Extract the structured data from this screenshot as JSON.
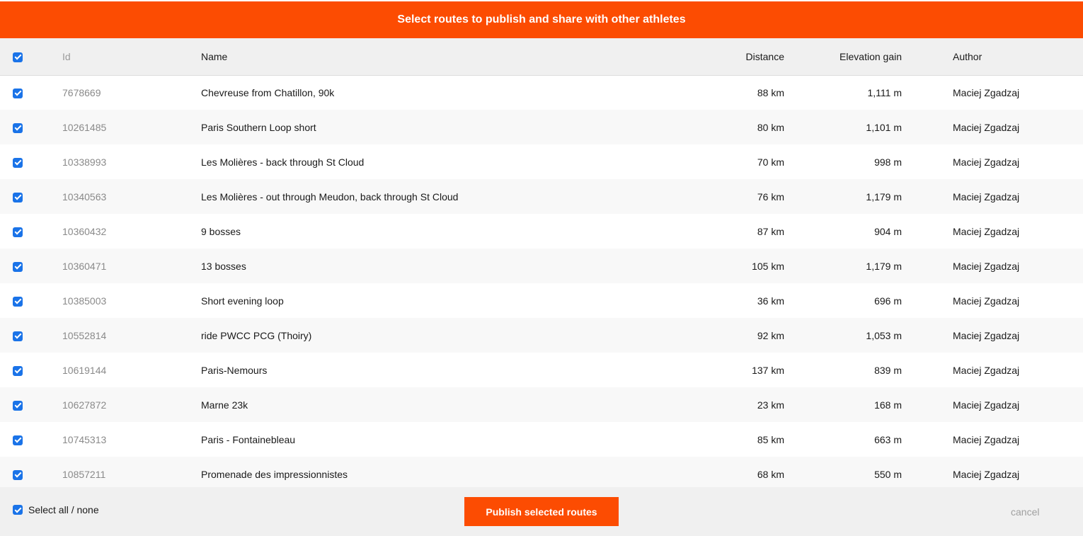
{
  "banner": {
    "title": "Select routes to publish and share with other athletes"
  },
  "colors": {
    "accent": "#fc4c02",
    "checkbox": "#1a73e8"
  },
  "table": {
    "header_checked": true,
    "columns": {
      "id": "Id",
      "name": "Name",
      "distance": "Distance",
      "elevation": "Elevation gain",
      "author": "Author"
    },
    "rows": [
      {
        "checked": true,
        "id": "7678669",
        "name": "Chevreuse from Chatillon, 90k",
        "distance": "88 km",
        "elevation": "1,111 m",
        "author": "Maciej Zgadzaj"
      },
      {
        "checked": true,
        "id": "10261485",
        "name": "Paris Southern Loop short",
        "distance": "80 km",
        "elevation": "1,101 m",
        "author": "Maciej Zgadzaj"
      },
      {
        "checked": true,
        "id": "10338993",
        "name": "Les Molières - back through St Cloud",
        "distance": "70 km",
        "elevation": "998 m",
        "author": "Maciej Zgadzaj"
      },
      {
        "checked": true,
        "id": "10340563",
        "name": "Les Molières - out through Meudon, back through St Cloud",
        "distance": "76 km",
        "elevation": "1,179 m",
        "author": "Maciej Zgadzaj"
      },
      {
        "checked": true,
        "id": "10360432",
        "name": "9 bosses",
        "distance": "87 km",
        "elevation": "904 m",
        "author": "Maciej Zgadzaj"
      },
      {
        "checked": true,
        "id": "10360471",
        "name": "13 bosses",
        "distance": "105 km",
        "elevation": "1,179 m",
        "author": "Maciej Zgadzaj"
      },
      {
        "checked": true,
        "id": "10385003",
        "name": "Short evening loop",
        "distance": "36 km",
        "elevation": "696 m",
        "author": "Maciej Zgadzaj"
      },
      {
        "checked": true,
        "id": "10552814",
        "name": "ride PWCC PCG (Thoiry)",
        "distance": "92 km",
        "elevation": "1,053 m",
        "author": "Maciej Zgadzaj"
      },
      {
        "checked": true,
        "id": "10619144",
        "name": "Paris-Nemours",
        "distance": "137 km",
        "elevation": "839 m",
        "author": "Maciej Zgadzaj"
      },
      {
        "checked": true,
        "id": "10627872",
        "name": "Marne 23k",
        "distance": "23 km",
        "elevation": "168 m",
        "author": "Maciej Zgadzaj"
      },
      {
        "checked": true,
        "id": "10745313",
        "name": "Paris - Fontainebleau",
        "distance": "85 km",
        "elevation": "663 m",
        "author": "Maciej Zgadzaj"
      },
      {
        "checked": true,
        "id": "10857211",
        "name": "Promenade des impressionnistes",
        "distance": "68 km",
        "elevation": "550 m",
        "author": "Maciej Zgadzaj"
      }
    ]
  },
  "footer": {
    "select_all_label": "Select all / none",
    "select_all_checked": true,
    "publish_label": "Publish selected routes",
    "cancel_label": "cancel"
  }
}
